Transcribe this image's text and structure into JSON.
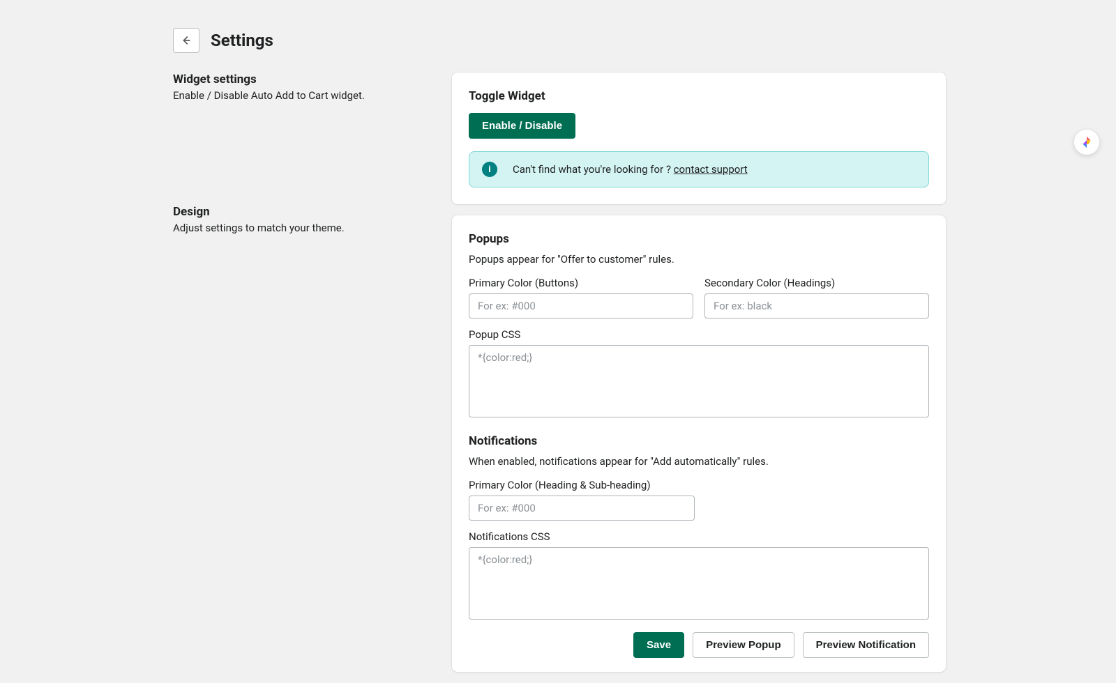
{
  "header": {
    "title": "Settings"
  },
  "sections": {
    "widget": {
      "title": "Widget settings",
      "desc": "Enable / Disable Auto Add to Cart widget."
    },
    "design": {
      "title": "Design",
      "desc": "Adjust settings to match your theme."
    }
  },
  "toggleCard": {
    "heading": "Toggle Widget",
    "buttonLabel": "Enable / Disable",
    "bannerText": "Can't find what you're looking for ? ",
    "bannerLink": "contact support"
  },
  "popups": {
    "heading": "Popups",
    "desc": "Popups appear for \"Offer to customer\" rules.",
    "primaryLabel": "Primary Color (Buttons)",
    "primaryPlaceholder": "For ex: #000",
    "secondaryLabel": "Secondary Color (Headings)",
    "secondaryPlaceholder": "For ex: black",
    "cssLabel": "Popup CSS",
    "cssPlaceholder": "*{color:red;}"
  },
  "notifications": {
    "heading": "Notifications",
    "desc": "When enabled, notifications appear for \"Add automatically\" rules.",
    "primaryLabel": "Primary Color (Heading & Sub-heading)",
    "primaryPlaceholder": "For ex: #000",
    "cssLabel": "Notifications CSS",
    "cssPlaceholder": "*{color:red;}"
  },
  "actions": {
    "save": "Save",
    "previewPopup": "Preview Popup",
    "previewNotification": "Preview Notification"
  }
}
